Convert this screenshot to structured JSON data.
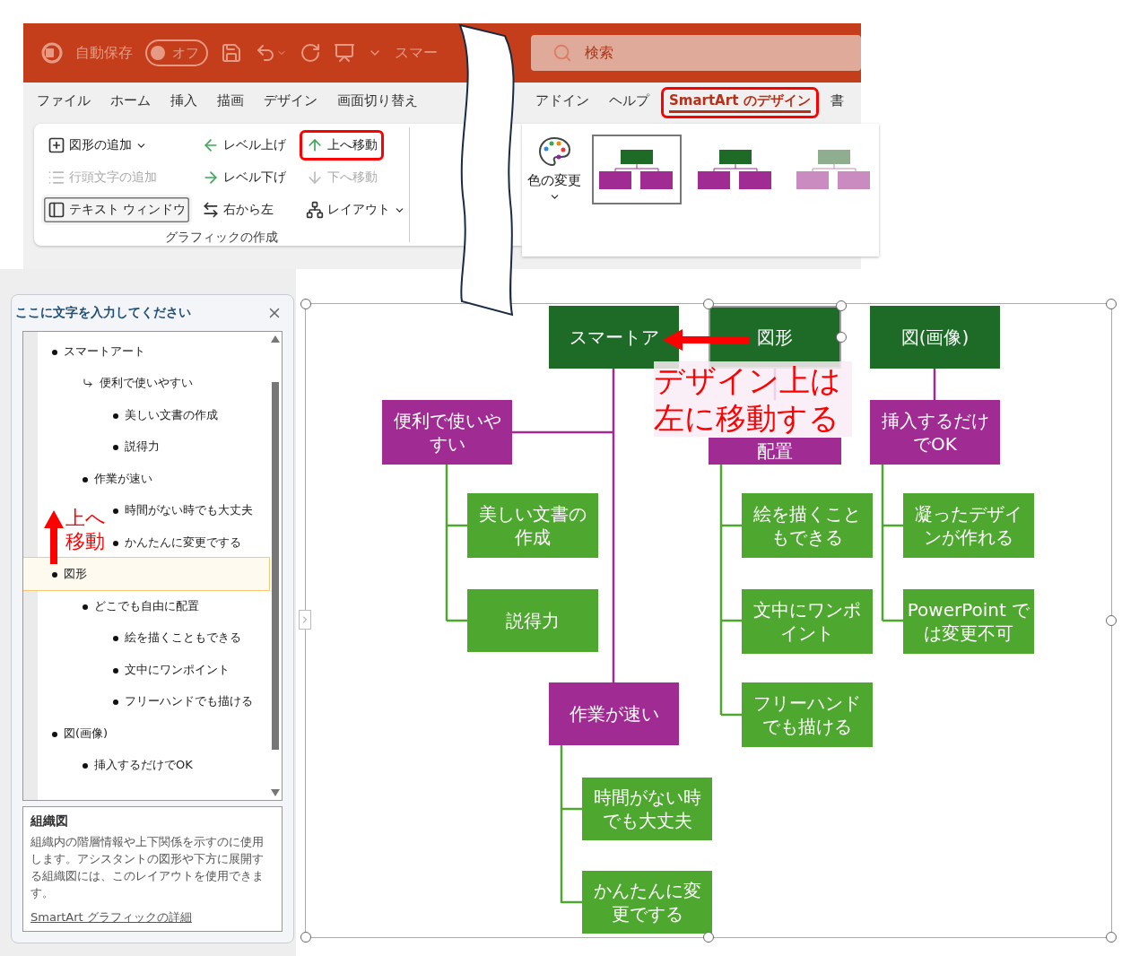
{
  "title_bar": {
    "autosave_label": "自動保存",
    "autosave_toggle": {
      "label": "オフ",
      "on": false
    },
    "document_title": "スマー",
    "search": {
      "placeholder": "検索"
    }
  },
  "ribbon_tabs": [
    {
      "label": "ファイル",
      "selected": false,
      "highlighted": false
    },
    {
      "label": "ホーム",
      "selected": false,
      "highlighted": false
    },
    {
      "label": "挿入",
      "selected": false,
      "highlighted": false
    },
    {
      "label": "描画",
      "selected": false,
      "highlighted": false
    },
    {
      "label": "デザイン",
      "selected": false,
      "highlighted": false
    },
    {
      "label": "画面切り替え",
      "selected": false,
      "highlighted": false
    },
    {
      "label": "アドイン",
      "selected": false,
      "highlighted": false
    },
    {
      "label": "ヘルプ",
      "selected": false,
      "highlighted": false
    },
    {
      "label": "SmartArt のデザイン",
      "selected": true,
      "highlighted": true
    },
    {
      "label": "書",
      "selected": false,
      "highlighted": false
    }
  ],
  "ribbon": {
    "create_graphic": {
      "label": "グラフィックの作成",
      "buttons": [
        {
          "label": "図形の追加",
          "disabled": false,
          "pressed": false,
          "dropdown": true,
          "highlighted": false
        },
        {
          "label": "行頭文字の追加",
          "disabled": true,
          "pressed": false,
          "dropdown": false,
          "highlighted": false
        },
        {
          "label": "テキスト ウィンドウ",
          "disabled": false,
          "pressed": true,
          "dropdown": false,
          "highlighted": false
        },
        {
          "label": "レベル上げ",
          "disabled": false,
          "pressed": false,
          "dropdown": false,
          "highlighted": false
        },
        {
          "label": "レベル下げ",
          "disabled": false,
          "pressed": false,
          "dropdown": false,
          "highlighted": false
        },
        {
          "label": "右から左",
          "disabled": false,
          "pressed": false,
          "dropdown": false,
          "highlighted": false
        },
        {
          "label": "上へ移動",
          "disabled": false,
          "pressed": false,
          "dropdown": false,
          "highlighted": true
        },
        {
          "label": "下へ移動",
          "disabled": true,
          "pressed": false,
          "dropdown": false,
          "highlighted": false
        },
        {
          "label": "レイアウト",
          "disabled": false,
          "pressed": false,
          "dropdown": true,
          "highlighted": false
        }
      ]
    },
    "change_colors": {
      "label": "色の変更"
    },
    "styles": [
      {
        "kind": "solid",
        "selected": true
      },
      {
        "kind": "solid",
        "selected": false
      },
      {
        "kind": "faded",
        "selected": false
      }
    ]
  },
  "text_pane": {
    "title": "ここに文字を入力してください",
    "items": [
      {
        "text": "スマートアート",
        "kind": "bullet",
        "selected": false,
        "children": [
          {
            "text": "便利で使いやすい",
            "kind": "assistant",
            "selected": false,
            "children": [
              {
                "text": "美しい文書の作成",
                "kind": "bullet",
                "selected": false
              },
              {
                "text": "説得力",
                "kind": "bullet",
                "selected": false
              }
            ]
          },
          {
            "text": "作業が速い",
            "kind": "bullet",
            "selected": false,
            "children": [
              {
                "text": "時間がない時でも大丈夫",
                "kind": "bullet",
                "selected": false
              },
              {
                "text": "かんたんに変更でする",
                "kind": "bullet",
                "selected": false
              }
            ]
          }
        ]
      },
      {
        "text": "図形",
        "kind": "bullet",
        "selected": true,
        "children": [
          {
            "text": "どこでも自由に配置",
            "kind": "bullet",
            "selected": false,
            "children": [
              {
                "text": "絵を描くこともできる",
                "kind": "bullet",
                "selected": false
              },
              {
                "text": "文中にワンポイント",
                "kind": "bullet",
                "selected": false
              },
              {
                "text": "フリーハンドでも描ける",
                "kind": "bullet",
                "selected": false
              }
            ]
          }
        ]
      },
      {
        "text": "図(画像)",
        "kind": "bullet",
        "selected": false,
        "children": [
          {
            "text": "挿入するだけでOK",
            "kind": "bullet",
            "selected": false
          }
        ]
      }
    ],
    "description": {
      "title": "組織図",
      "text": "組織内の階層情報や上下関係を示すのに使用します。アシスタントの図形や下方に展開する組織図には、このレイアウトを使用できます。",
      "link": "SmartArt グラフィックの詳細"
    }
  },
  "diagram": {
    "nodes": [
      {
        "text": "スマートア",
        "kind": "top",
        "selected": false,
        "covered": false
      },
      {
        "text": "図形",
        "kind": "top",
        "selected": true,
        "covered": false
      },
      {
        "text": "図(画像)",
        "kind": "top",
        "selected": false,
        "covered": false
      },
      {
        "text": "便利で使いやすい",
        "kind": "middle",
        "selected": false,
        "covered": false
      },
      {
        "text": "配置",
        "kind": "middle",
        "selected": false,
        "covered": true
      },
      {
        "text": "挿入するだけでOK",
        "kind": "middle",
        "selected": false,
        "covered": false
      },
      {
        "text": "美しい文書の作成",
        "kind": "leaf",
        "selected": false,
        "covered": false
      },
      {
        "text": "説得力",
        "kind": "leaf",
        "selected": false,
        "covered": false
      },
      {
        "text": "作業が速い",
        "kind": "middle",
        "selected": false,
        "covered": false
      },
      {
        "text": "時間がない時でも大丈夫",
        "kind": "leaf",
        "selected": false,
        "covered": false
      },
      {
        "text": "かんたんに変更でする",
        "kind": "leaf",
        "selected": false,
        "covered": false
      },
      {
        "text": "絵を描くこともできる",
        "kind": "leaf",
        "selected": false,
        "covered": false
      },
      {
        "text": "文中にワンポイント",
        "kind": "leaf",
        "selected": false,
        "covered": false
      },
      {
        "text": "フリーハンドでも描ける",
        "kind": "leaf",
        "selected": false,
        "covered": false
      },
      {
        "text": "凝ったデザインが作れる",
        "kind": "leaf",
        "selected": false,
        "covered": false
      },
      {
        "text": "PowerPoint では変更不可",
        "kind": "leaf",
        "selected": false,
        "covered": false
      }
    ]
  },
  "annotations": [
    {
      "kind": "pane",
      "text": "上へ移動"
    },
    {
      "kind": "canvas",
      "text": "デザイン上は左に移動する"
    }
  ]
}
